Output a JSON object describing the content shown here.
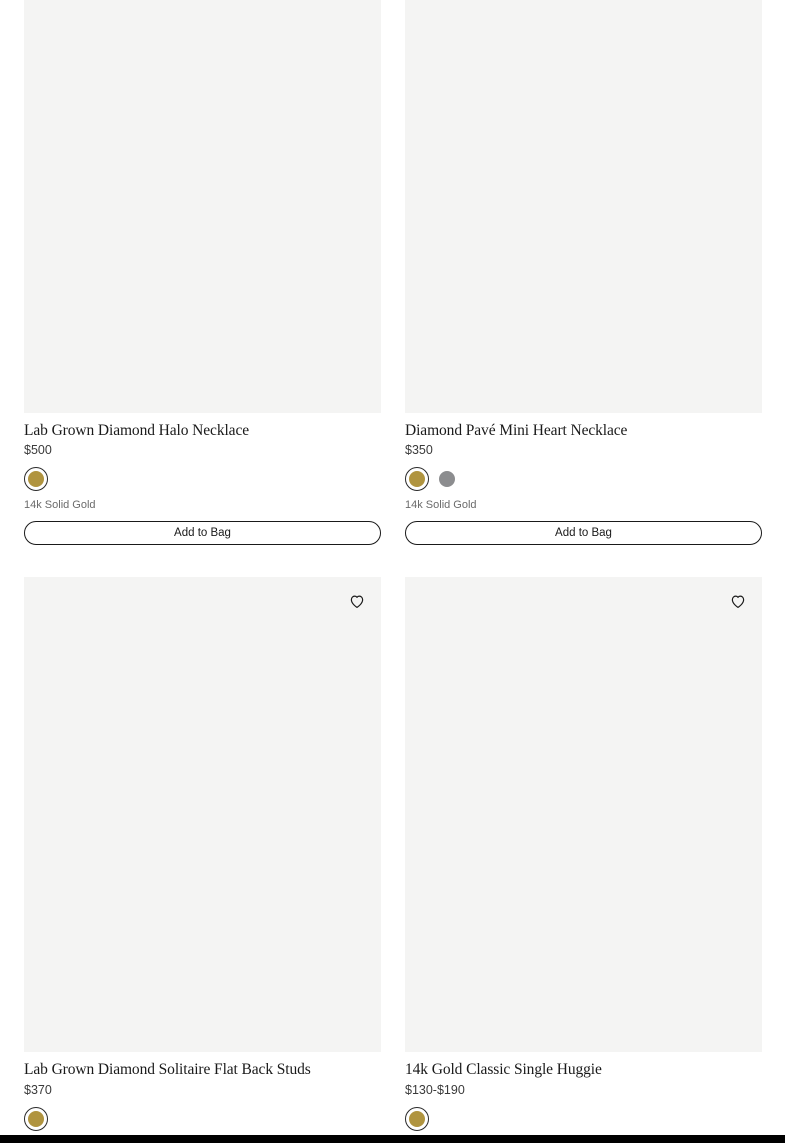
{
  "colors": {
    "gold": "#b0943f",
    "silver": "#8c8d8f",
    "image_bg": "#f4f4f3"
  },
  "products": [
    {
      "title": "Lab Grown Diamond Halo Necklace",
      "price": "$500",
      "swatches": [
        {
          "name": "gold",
          "selected": true
        }
      ],
      "metal": "14k Solid Gold",
      "add_label": "Add to Bag",
      "wishlist_icon": "heart-outline-icon"
    },
    {
      "title": "Diamond Pavé Mini Heart Necklace",
      "price": "$350",
      "swatches": [
        {
          "name": "gold",
          "selected": true
        },
        {
          "name": "silver",
          "selected": false
        }
      ],
      "metal": "14k Solid Gold",
      "add_label": "Add to Bag",
      "wishlist_icon": "heart-outline-icon"
    },
    {
      "title": "Lab Grown Diamond Solitaire Flat Back Studs",
      "price": "$370",
      "swatches": [
        {
          "name": "gold",
          "selected": true
        }
      ],
      "wishlist_icon": "heart-outline-icon"
    },
    {
      "title": "14k Gold Classic Single Huggie",
      "price": "$130-$190",
      "swatches": [
        {
          "name": "gold",
          "selected": true
        }
      ],
      "wishlist_icon": "heart-outline-icon"
    }
  ]
}
